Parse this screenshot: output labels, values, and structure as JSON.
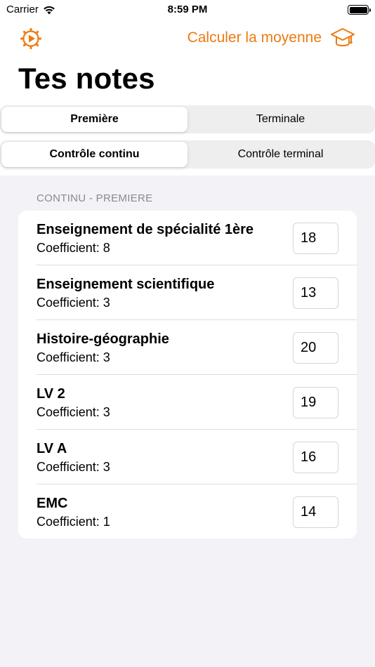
{
  "status_bar": {
    "carrier": "Carrier",
    "time": "8:59 PM"
  },
  "nav": {
    "settings_icon": "gear-icon",
    "average_label": "Calculer la moyenne",
    "average_icon": "graduation-cap-icon"
  },
  "title": "Tes notes",
  "year_tabs": [
    {
      "label": "Première",
      "selected": true
    },
    {
      "label": "Terminale",
      "selected": false
    }
  ],
  "mode_tabs": [
    {
      "label": "Contrôle continu",
      "selected": true
    },
    {
      "label": "Contrôle terminal",
      "selected": false
    }
  ],
  "section": {
    "header": "CONTINU - PREMIERE",
    "rows": [
      {
        "subject": "Enseignement de spécialité 1ère",
        "coefficient": "Coefficient: 8",
        "grade": "18"
      },
      {
        "subject": "Enseignement scientifique",
        "coefficient": "Coefficient: 3",
        "grade": "13"
      },
      {
        "subject": "Histoire-géographie",
        "coefficient": "Coefficient: 3",
        "grade": "20"
      },
      {
        "subject": "LV 2",
        "coefficient": "Coefficient: 3",
        "grade": "19"
      },
      {
        "subject": "LV A",
        "coefficient": "Coefficient: 3",
        "grade": "16"
      },
      {
        "subject": "EMC",
        "coefficient": "Coefficient: 1",
        "grade": "14"
      }
    ]
  },
  "colors": {
    "accent": "#ee7a10",
    "background": "#f2f2f7",
    "card": "#ffffff"
  }
}
